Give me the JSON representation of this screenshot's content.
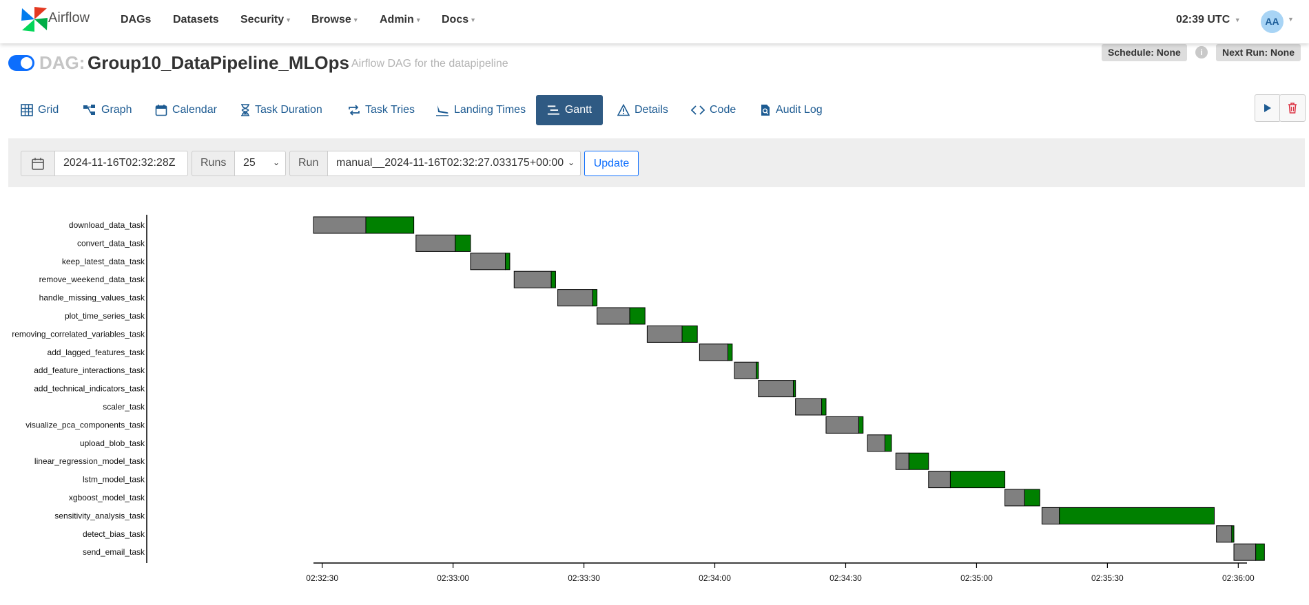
{
  "nav": {
    "brand": "Airflow",
    "items": [
      {
        "label": "DAGs",
        "dropdown": false
      },
      {
        "label": "Datasets",
        "dropdown": false
      },
      {
        "label": "Security",
        "dropdown": true
      },
      {
        "label": "Browse",
        "dropdown": true
      },
      {
        "label": "Admin",
        "dropdown": true
      },
      {
        "label": "Docs",
        "dropdown": true
      }
    ],
    "clock": "02:39 UTC",
    "avatar": "AA"
  },
  "dag": {
    "prefix": "DAG:",
    "id": "Group10_DataPipeline_MLOps",
    "description": "Airflow DAG for the datapipeline",
    "paused": false,
    "schedule": "Schedule: None",
    "next_run": "Next Run: None"
  },
  "tabs": [
    {
      "label": "Grid",
      "icon": "grid-icon"
    },
    {
      "label": "Graph",
      "icon": "graph-icon"
    },
    {
      "label": "Calendar",
      "icon": "calendar-icon"
    },
    {
      "label": "Task Duration",
      "icon": "hourglass-icon"
    },
    {
      "label": "Task Tries",
      "icon": "retry-icon"
    },
    {
      "label": "Landing Times",
      "icon": "landing-icon"
    },
    {
      "label": "Gantt",
      "icon": "gantt-icon",
      "active": true
    },
    {
      "label": "Details",
      "icon": "warning-icon"
    },
    {
      "label": "Code",
      "icon": "code-icon"
    },
    {
      "label": "Audit Log",
      "icon": "audit-icon"
    }
  ],
  "filters": {
    "base_date": "2024-11-16T02:32:28Z",
    "runs_label": "Runs",
    "runs_value": "25",
    "run_label": "Run",
    "run_value": "manual__2024-11-16T02:32:27.033175+00:00",
    "update_label": "Update"
  },
  "colors": {
    "queued": "#808080",
    "success": "#008000",
    "accent": "#0d6efd",
    "active_tab": "#2f5a83"
  },
  "chart_data": {
    "type": "gantt",
    "x_axis": {
      "type": "time",
      "range": [
        "02:32:28",
        "02:36:02"
      ],
      "ticks": [
        "02:32:30",
        "02:33:00",
        "02:33:30",
        "02:34:00",
        "02:34:30",
        "02:35:00",
        "02:35:30",
        "02:36:00"
      ]
    },
    "legend": {
      "queued": "gray segment",
      "running_success": "green segment"
    },
    "tasks": [
      {
        "label": "download_data_task",
        "queued": "02:32:28",
        "start": "02:32:40",
        "end": "02:32:51"
      },
      {
        "label": "convert_data_task",
        "queued": "02:32:51.5",
        "start": "02:33:00.5",
        "end": "02:33:04"
      },
      {
        "label": "keep_latest_data_task",
        "queued": "02:33:04",
        "start": "02:33:12",
        "end": "02:33:13"
      },
      {
        "label": "remove_weekend_data_task",
        "queued": "02:33:14",
        "start": "02:33:22.5",
        "end": "02:33:23.5"
      },
      {
        "label": "handle_missing_values_task",
        "queued": "02:33:24",
        "start": "02:33:32",
        "end": "02:33:33"
      },
      {
        "label": "plot_time_series_task",
        "queued": "02:33:33",
        "start": "02:33:40.5",
        "end": "02:33:44"
      },
      {
        "label": "removing_correlated_variables_task",
        "queued": "02:33:44.5",
        "start": "02:33:52.5",
        "end": "02:33:56"
      },
      {
        "label": "add_lagged_features_task",
        "queued": "02:33:56.5",
        "start": "02:34:03",
        "end": "02:34:04"
      },
      {
        "label": "add_feature_interactions_task",
        "queued": "02:34:04.5",
        "start": "02:34:09.5",
        "end": "02:34:10"
      },
      {
        "label": "add_technical_indicators_task",
        "queued": "02:34:10",
        "start": "02:34:18",
        "end": "02:34:18.5"
      },
      {
        "label": "scaler_task",
        "queued": "02:34:18.5",
        "start": "02:34:24.5",
        "end": "02:34:25.5"
      },
      {
        "label": "visualize_pca_components_task",
        "queued": "02:34:25.5",
        "start": "02:34:33",
        "end": "02:34:34"
      },
      {
        "label": "upload_blob_task",
        "queued": "02:34:35",
        "start": "02:34:39",
        "end": "02:34:40.5"
      },
      {
        "label": "linear_regression_model_task",
        "queued": "02:34:41.5",
        "start": "02:34:44.5",
        "end": "02:34:49"
      },
      {
        "label": "lstm_model_task",
        "queued": "02:34:49",
        "start": "02:34:54",
        "end": "02:35:06.5"
      },
      {
        "label": "xgboost_model_task",
        "queued": "02:35:06.5",
        "start": "02:35:11",
        "end": "02:35:14.5"
      },
      {
        "label": "sensitivity_analysis_task",
        "queued": "02:35:15",
        "start": "02:35:19",
        "end": "02:35:54.5"
      },
      {
        "label": "detect_bias_task",
        "queued": "02:35:55",
        "start": "02:35:58.5",
        "end": "02:35:59"
      },
      {
        "label": "send_email_task",
        "queued": "02:35:59",
        "start": "02:36:04",
        "end": "02:36:06"
      }
    ]
  }
}
